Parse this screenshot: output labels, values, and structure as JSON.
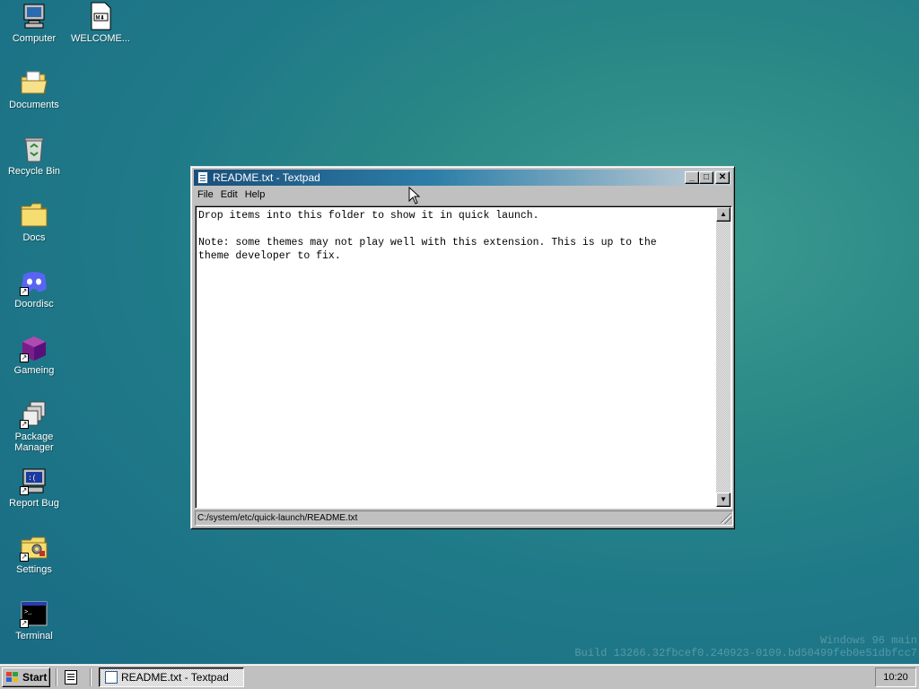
{
  "desktop": {
    "icons": [
      {
        "label": "Computer",
        "icon": "computer-icon"
      },
      {
        "label": "WELCOME...",
        "icon": "markdown-file-icon"
      },
      {
        "label": "Documents",
        "icon": "documents-folder-icon"
      },
      {
        "label": "Recycle Bin",
        "icon": "recycle-bin-icon"
      },
      {
        "label": "Docs",
        "icon": "folder-icon"
      },
      {
        "label": "Doordisc",
        "icon": "discord-icon"
      },
      {
        "label": "Gameing",
        "icon": "game-cube-icon"
      },
      {
        "label": "Package Manager",
        "icon": "package-manager-icon"
      },
      {
        "label": "Report Bug",
        "icon": "report-bug-icon"
      },
      {
        "label": "Settings",
        "icon": "settings-folder-icon"
      },
      {
        "label": "Terminal",
        "icon": "terminal-icon"
      }
    ]
  },
  "window": {
    "title": "README.txt - Textpad",
    "menu": [
      "File",
      "Edit",
      "Help"
    ],
    "content": "Drop items into this folder to show it in quick launch.\n\nNote: some themes may not play well with this extension. This is up to the\ntheme developer to fix.",
    "status_path": "C:/system/etc/quick-launch/README.txt"
  },
  "watermark": {
    "line1": "Windows 96 main",
    "line2": "Build 13266.32fbcef0.240923-0109.bd50499feb0e51dbfcc7"
  },
  "taskbar": {
    "start_label": "Start",
    "task_label": "README.txt - Textpad",
    "clock": "10:20"
  },
  "colors": {
    "desktop": "#1f7a88",
    "titlebar_start": "#1a4f7a",
    "chrome": "#c0c0c0"
  }
}
